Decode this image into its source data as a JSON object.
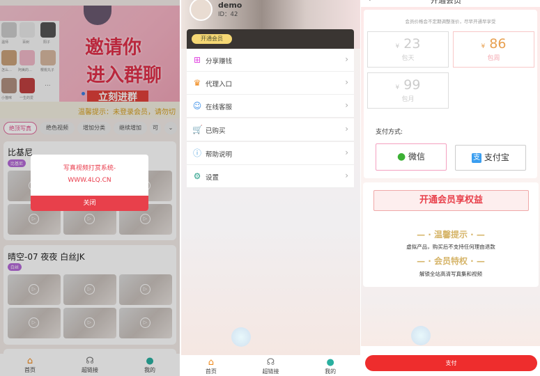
{
  "home": {
    "banner": {
      "line1": "邀请你",
      "line2": "进入群聊",
      "cta": "立刻进群",
      "avatars": [
        "温师",
        "百树",
        "阳子",
        "怎么…",
        "阿美的…",
        "樱桃丸子",
        "小猫咪",
        "一生的爱",
        "..."
      ]
    },
    "notice": "温馨提示：未登录会员，请勿切",
    "tabs": [
      "绝顶写真",
      "绝色视频",
      "增加分类",
      "继续增加",
      "可"
    ],
    "active_tab": 0,
    "sections": [
      {
        "title": "比基尼",
        "tag": "比基尼"
      },
      {
        "title": "晴空-07 夜夜 白丝JK",
        "tag": "白丝"
      }
    ],
    "modal": {
      "line1": "写真视频打赏系统-",
      "line2": "WWW.4LQ.CN",
      "close": "关闭"
    }
  },
  "nav": [
    {
      "label": "首页",
      "icon": "home-icon"
    },
    {
      "label": "超链接",
      "icon": "headset-icon"
    },
    {
      "label": "我的",
      "icon": "user-icon"
    }
  ],
  "profile": {
    "name": "demo",
    "id": "ID：42",
    "vip_button": "开通会员",
    "menu": [
      {
        "label": "分享赚钱",
        "icon": "gift-icon",
        "color": "#e040e0"
      },
      {
        "label": "代理入口",
        "icon": "vip-crown-icon",
        "color": "#f08a1c"
      },
      {
        "label": "在线客服",
        "icon": "chat-icon",
        "color": "#3a8ee8"
      },
      {
        "label": "已购买",
        "icon": "cart-icon",
        "color": "#f29a1a"
      },
      {
        "label": "帮助说明",
        "icon": "help-icon",
        "color": "#5aa8e0"
      },
      {
        "label": "设置",
        "icon": "gear-icon",
        "color": "#2aa08a"
      }
    ]
  },
  "vip": {
    "title": "开通会员",
    "note": "会员价格会不定期调整涨价，尽早开通早享受",
    "currency": "¥",
    "plans": [
      {
        "price": "23",
        "label": "包天"
      },
      {
        "price": "86",
        "label": "包周"
      },
      {
        "price": "99",
        "label": "包月"
      }
    ],
    "selected_plan": 1,
    "pay_method_label": "支付方式:",
    "methods": [
      {
        "label": "微信",
        "icon": "wechat-icon"
      },
      {
        "label": "支付宝",
        "icon": "alipay-icon"
      }
    ],
    "selected_method": 0,
    "benefits_title": "开通会员享权益",
    "tip_heading": "温馨提示",
    "tip_text": "虚拟产品，购买后不支持任何理由退款",
    "priv_heading": "会员特权",
    "priv_text": "解锁全站高清写真集和视频",
    "pay_button": "支付"
  },
  "colors": {
    "accent": "#e8404b",
    "gold": "#f5d774",
    "selected_price": "#e8a050"
  }
}
